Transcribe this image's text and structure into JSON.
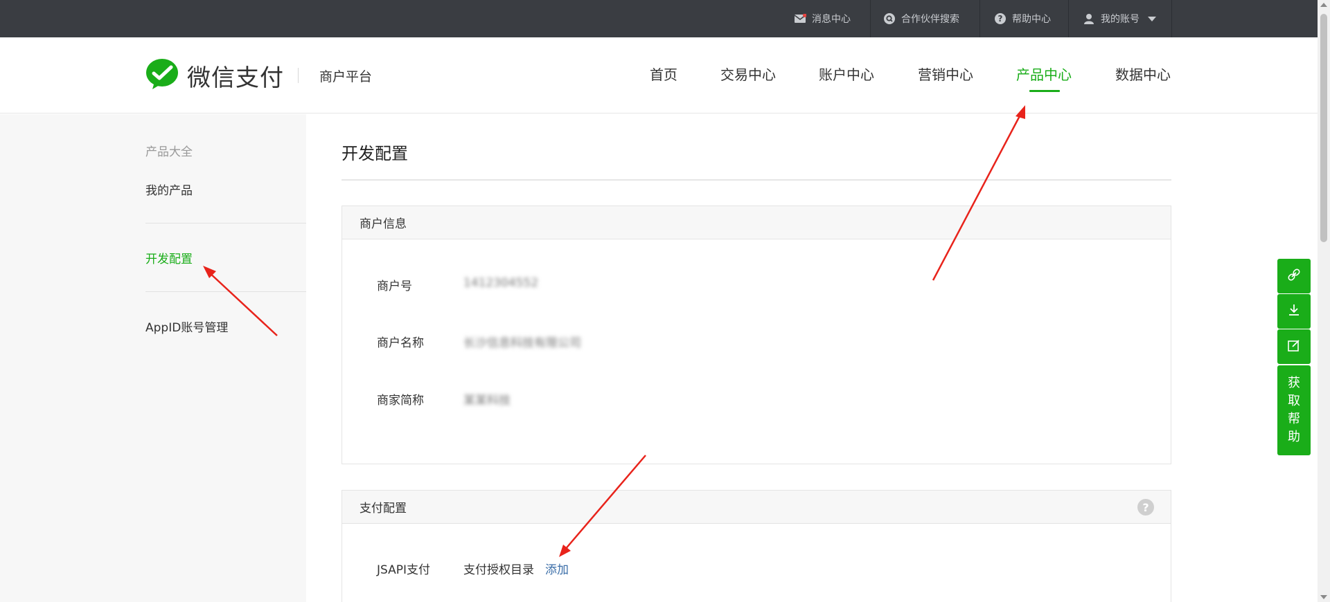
{
  "topbar": {
    "messages_label": "消息中心",
    "partner_search_label": "合作伙伴搜索",
    "help_center_label": "帮助中心",
    "account_label": "我的账号"
  },
  "header": {
    "brand_name": "微信支付",
    "platform_name": "商户平台",
    "nav": [
      "首页",
      "交易中心",
      "账户中心",
      "营销中心",
      "产品中心",
      "数据中心"
    ],
    "active_nav": "产品中心"
  },
  "sidebar": {
    "items": [
      "产品大全",
      "我的产品",
      "开发配置",
      "AppID账号管理"
    ],
    "active_item": "开发配置"
  },
  "main": {
    "title": "开发配置",
    "merchant_info": {
      "header": "商户信息",
      "rows": [
        {
          "label": "商户号",
          "value": "1412304552"
        },
        {
          "label": "商户名称",
          "value": "长沙信息科技有限公司"
        },
        {
          "label": "商家简称",
          "value": "某某科技"
        }
      ]
    },
    "payment_config": {
      "header": "支付配置",
      "jsapi_label": "JSAPI支付",
      "auth_dir_label": "支付授权目录",
      "add_link": "添加"
    }
  },
  "floating_tools": {
    "help_label": "获取帮助",
    "help_chars": [
      "获",
      "取",
      "帮",
      "助"
    ]
  },
  "colors": {
    "accent": "#1aad19",
    "topbar_bg": "#3a3d42",
    "link": "#3b6ea8",
    "annotation_arrow": "#e8231b"
  }
}
